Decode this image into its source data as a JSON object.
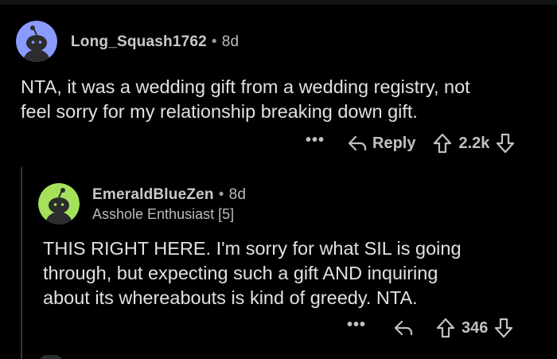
{
  "comments": [
    {
      "username": "Long_Squash1762",
      "separator": "•",
      "age": "8d",
      "body_lines": [
        "NTA, it was a wedding gift from a wedding registry, not",
        "feel sorry for my relationship breaking down gift."
      ],
      "more_label": "•••",
      "reply_label": "Reply",
      "score": "2.2k",
      "avatar_color": "#8a9bff"
    },
    {
      "username": "EmeraldBlueZen",
      "separator": "•",
      "age": "8d",
      "flair": "Asshole Enthusiast [5]",
      "body_lines": [
        "THIS RIGHT HERE. I'm sorry for what SIL is going",
        "through, but expecting such a gift AND inquiring",
        "about its whereabouts is kind of greedy.  NTA."
      ],
      "more_label": "•••",
      "score": "346",
      "avatar_color": "#a5e25a"
    }
  ],
  "icons": {
    "reply": "reply-arrow-icon",
    "upvote": "upvote-arrow-icon",
    "downvote": "downvote-arrow-icon",
    "avatar": "snoo-avatar-icon"
  }
}
